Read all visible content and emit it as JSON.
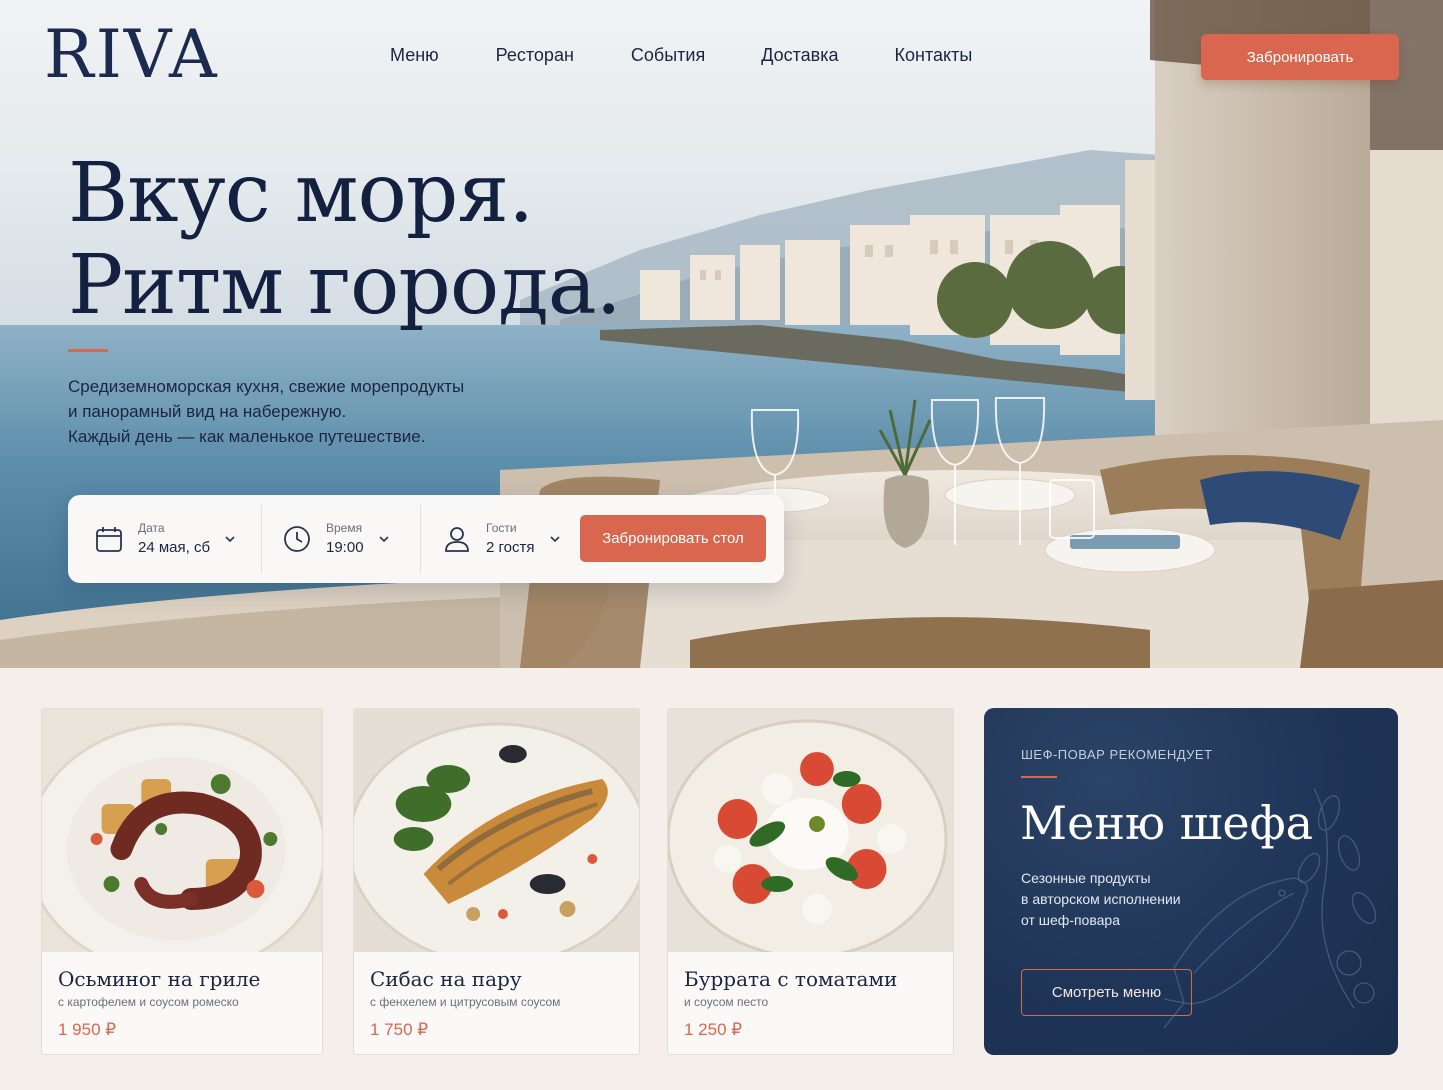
{
  "brand": {
    "logo": "RIVA"
  },
  "nav": {
    "items": [
      "Меню",
      "Ресторан",
      "События",
      "Доставка",
      "Контакты"
    ],
    "book_button": "Забронировать"
  },
  "hero": {
    "title_line1": "Вкус моря.",
    "title_line2": "Ритм города.",
    "subtitle_lines": [
      "Средиземноморская кухня, свежие морепродукты",
      "и панорамный вид на набережную.",
      "Каждый день — как маленькое путешествие."
    ]
  },
  "booking": {
    "date_label": "Дата",
    "date_value": "24 мая, сб",
    "time_label": "Время",
    "time_value": "19:00",
    "guests_label": "Гости",
    "guests_value": "2 гостя",
    "submit": "Забронировать стол",
    "icons": [
      "calendar-icon",
      "clock-icon",
      "user-icon",
      "chevron-down-icon"
    ]
  },
  "dishes": [
    {
      "title": "Осьминог на гриле",
      "desc": "с картофелем и соусом ромеско",
      "price": "1 950 ₽"
    },
    {
      "title": "Сибас на пару",
      "desc": "с фенхелем и цитрусовым соусом",
      "price": "1 750 ₽"
    },
    {
      "title": "Буррата с томатами",
      "desc": "и соусом песто",
      "price": "1 250 ₽"
    }
  ],
  "chef": {
    "kicker": "ШЕФ-ПОВАР РЕКОМЕНДУЕТ",
    "title": "Меню шефа",
    "text_lines": [
      "Сезонные продукты",
      "в авторском исполнении",
      "от шеф-повара"
    ],
    "button": "Смотреть меню"
  },
  "colors": {
    "accent": "#d9674f",
    "navy": "#1b2a4e",
    "background": "#f4efea",
    "chef_card": "#1f3558"
  }
}
